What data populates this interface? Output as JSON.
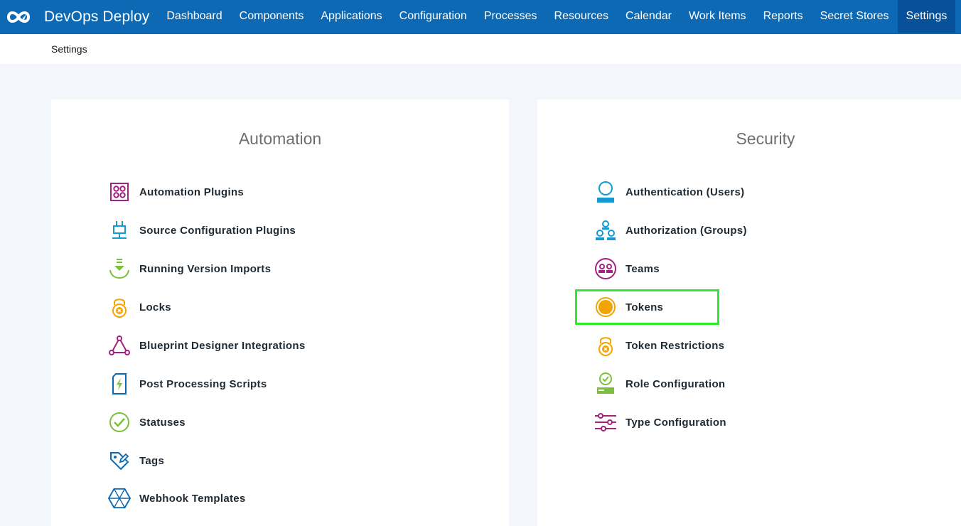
{
  "app": {
    "name": "DevOps Deploy",
    "logo_icon": "infinity-rocket-logo-icon"
  },
  "nav": {
    "items": [
      {
        "label": "Dashboard"
      },
      {
        "label": "Components"
      },
      {
        "label": "Applications"
      },
      {
        "label": "Configuration"
      },
      {
        "label": "Processes"
      },
      {
        "label": "Resources"
      },
      {
        "label": "Calendar"
      },
      {
        "label": "Work Items"
      },
      {
        "label": "Reports"
      },
      {
        "label": "Secret Stores"
      },
      {
        "label": "Settings",
        "active": true
      }
    ]
  },
  "breadcrumb": "Settings",
  "automation": {
    "title": "Automation",
    "items": [
      {
        "label": "Automation Plugins",
        "icon": "plugin-grid-icon"
      },
      {
        "label": "Source Configuration Plugins",
        "icon": "plug-icon"
      },
      {
        "label": "Running Version Imports",
        "icon": "download-import-icon"
      },
      {
        "label": "Locks",
        "icon": "lock-icon"
      },
      {
        "label": "Blueprint Designer Integrations",
        "icon": "triangle-nodes-icon"
      },
      {
        "label": "Post Processing Scripts",
        "icon": "script-bolt-icon"
      },
      {
        "label": "Statuses",
        "icon": "check-circle-icon"
      },
      {
        "label": "Tags",
        "icon": "tag-edit-icon"
      },
      {
        "label": "Webhook Templates",
        "icon": "hexagon-web-icon"
      }
    ]
  },
  "security": {
    "title": "Security",
    "items": [
      {
        "label": "Authentication (Users)",
        "icon": "user-icon"
      },
      {
        "label": "Authorization (Groups)",
        "icon": "group-icon"
      },
      {
        "label": "Teams",
        "icon": "team-icon"
      },
      {
        "label": "Tokens",
        "icon": "token-coin-icon",
        "highlighted": true
      },
      {
        "label": "Token Restrictions",
        "icon": "lock-icon"
      },
      {
        "label": "Role Configuration",
        "icon": "role-check-icon"
      },
      {
        "label": "Type Configuration",
        "icon": "sliders-icon"
      }
    ]
  },
  "colors": {
    "nav_bg": "#0d69b3",
    "nav_active": "#06519a",
    "highlight": "#2ee82e",
    "magenta": "#a3227f",
    "blue": "#1699d3",
    "green": "#7bbf3a",
    "orange": "#f4a400",
    "navy": "#0d69b3"
  }
}
